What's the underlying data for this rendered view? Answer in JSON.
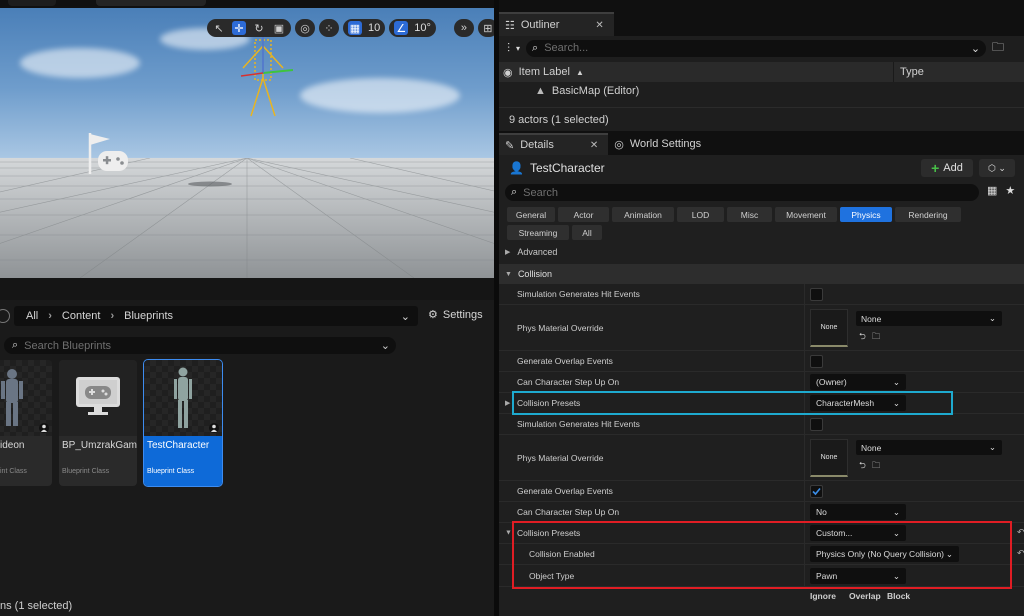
{
  "viewport": {
    "grid_snap": "10",
    "rotation_snap": "10°",
    "tools": [
      "select-tool",
      "translate-tool",
      "rotate-tool",
      "scale-tool"
    ]
  },
  "content_browser": {
    "breadcrumb": [
      "All",
      "Content",
      "Blueprints"
    ],
    "settings_label": "Settings",
    "search_placeholder": "Search Blueprints",
    "assets": [
      {
        "name": "ideon",
        "class": "int Class",
        "selected": false
      },
      {
        "name": "BP_UmzrakGameMode",
        "class": "Blueprint Class",
        "selected": false
      },
      {
        "name": "TestCharacter",
        "class": "Blueprint Class",
        "selected": true
      }
    ],
    "status": "ns (1 selected)"
  },
  "outliner": {
    "tab_label": "Outliner",
    "search_placeholder": "Search...",
    "col_item_label": "Item Label",
    "col_type": "Type",
    "rows": [
      {
        "label": "BasicMap (Editor)"
      }
    ],
    "status": "9 actors (1 selected)"
  },
  "details": {
    "tab_label": "Details",
    "tab2_label": "World Settings",
    "actor_name": "TestCharacter",
    "add_label": "Add",
    "search_placeholder": "Search",
    "filters": [
      {
        "label": "General",
        "active": false
      },
      {
        "label": "Actor",
        "active": false
      },
      {
        "label": "Animation",
        "active": false
      },
      {
        "label": "LOD",
        "active": false
      },
      {
        "label": "Misc",
        "active": false
      },
      {
        "label": "Movement",
        "active": false
      },
      {
        "label": "Physics",
        "active": true
      },
      {
        "label": "Rendering",
        "active": false
      },
      {
        "label": "Streaming",
        "active": false
      },
      {
        "label": "All",
        "active": false
      }
    ],
    "advanced_label": "Advanced",
    "category": "Collision",
    "props": {
      "sim_hit_1": "Simulation Generates Hit Events",
      "phys_mat_1": "Phys Material Override",
      "phys_mat_1_thumb": "None",
      "phys_mat_1_value": "None",
      "overlap_1": "Generate Overlap Events",
      "step_up_1": "Can Character Step Up On",
      "step_up_1_value": "(Owner)",
      "presets_1": "Collision Presets",
      "presets_1_value": "CharacterMesh",
      "sim_hit_2": "Simulation Generates Hit Events",
      "phys_mat_2": "Phys Material Override",
      "phys_mat_2_thumb": "None",
      "phys_mat_2_value": "None",
      "overlap_2": "Generate Overlap Events",
      "step_up_2": "Can Character Step Up On",
      "step_up_2_value": "No",
      "presets_2": "Collision Presets",
      "presets_2_value": "Custom...",
      "collision_enabled": "Collision Enabled",
      "collision_enabled_value": "Physics Only (No Query Collision)",
      "object_type": "Object Type",
      "object_type_value": "Pawn"
    },
    "response_headers": [
      "Ignore",
      "Overlap",
      "Block"
    ]
  },
  "colors": {
    "accent_blue": "#1f72df",
    "highlight_cyan": "#1eaacf",
    "highlight_red": "#e01d24",
    "add_green": "#48c048"
  }
}
